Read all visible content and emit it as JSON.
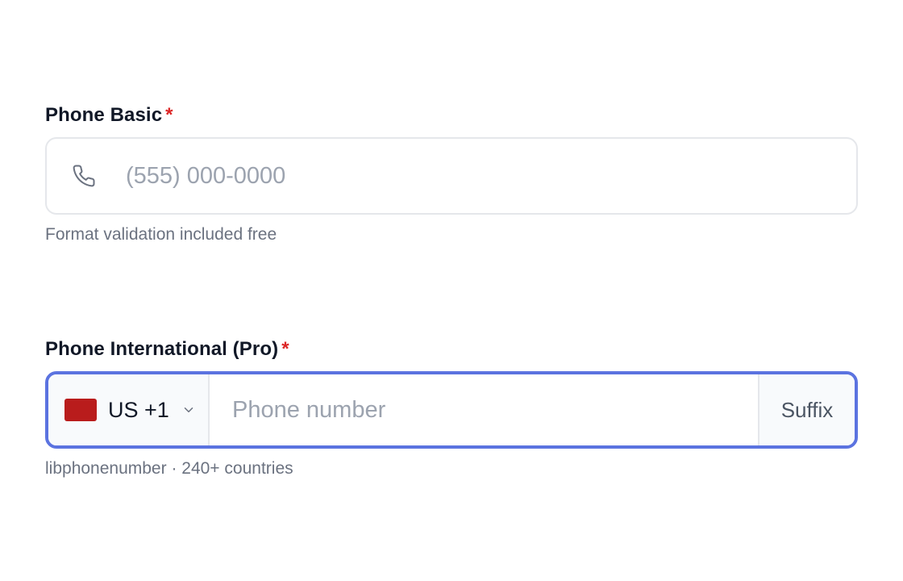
{
  "phone_basic": {
    "label": "Phone Basic",
    "required_marker": "*",
    "icon": "phone-icon",
    "value": "",
    "placeholder": "(555) 000-0000",
    "help_text": "Format validation included free"
  },
  "phone_international": {
    "label": "Phone International (Pro)",
    "required_marker": "*",
    "country": {
      "flag_color": "#b91c1c",
      "code_label": "US +1",
      "icon": "chevron-down-icon"
    },
    "value": "",
    "placeholder": "Phone number",
    "suffix": "Suffix",
    "help_text": "libphonenumber · 240+ countries"
  },
  "colors": {
    "focus_border": "#5b73e0",
    "required": "#dc2626",
    "placeholder": "#9ca3af"
  }
}
